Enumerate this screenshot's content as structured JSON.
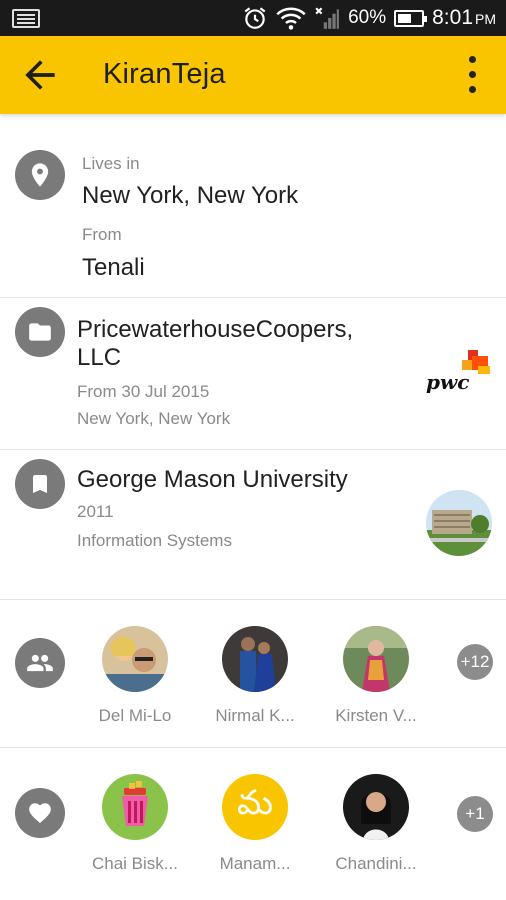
{
  "status_bar": {
    "battery": "60%",
    "battery_level": 0.6,
    "time": "8:01",
    "ampm": "PM"
  },
  "toolbar": {
    "title": "KiranTeja",
    "back_icon": "arrow-back-icon",
    "menu_icon": "more-vert-icon"
  },
  "location": {
    "lives_in_label": "Lives in",
    "lives_in_value": "New York, New York",
    "from_label": "From",
    "from_value": "Tenali"
  },
  "work": {
    "company_line1": "PricewaterhouseCoopers,",
    "company_line2": "LLC",
    "since": "From 30 Jul 2015",
    "location": "New York, New York",
    "logo_text": "pwc"
  },
  "education": {
    "school": "George Mason University",
    "year": "2011",
    "field": "Information Systems"
  },
  "friends": {
    "icon": "people-icon",
    "items": [
      {
        "name": "Del Mi-Lo"
      },
      {
        "name": "Nirmal K..."
      },
      {
        "name": "Kirsten V..."
      }
    ],
    "more": "+12"
  },
  "likes": {
    "icon": "heart-icon",
    "items": [
      {
        "name": "Chai Bisk..."
      },
      {
        "name": "Manam..."
      },
      {
        "name": "Chandini..."
      }
    ],
    "more": "+1",
    "manam_glyph": "మ"
  },
  "colors": {
    "toolbar": "#f9c500",
    "icon_circle": "#7a7a7a"
  }
}
